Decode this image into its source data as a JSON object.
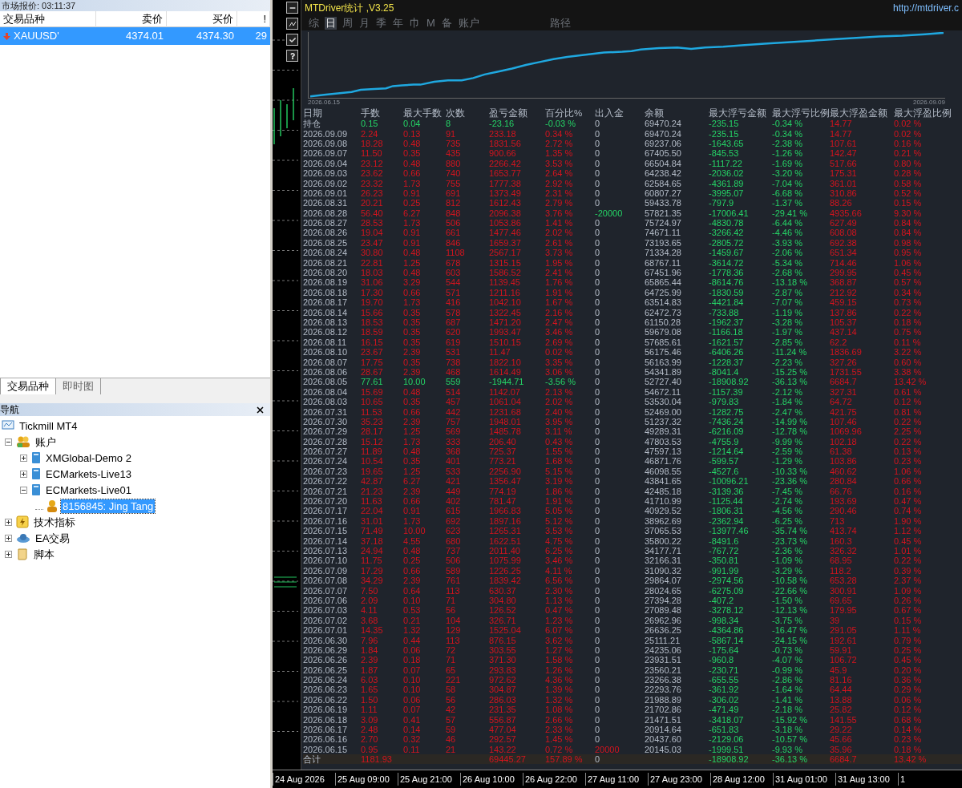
{
  "market_watch": {
    "title": "市场报价: 03:11:37",
    "columns": [
      "交易品种",
      "卖价",
      "买价",
      "!"
    ],
    "rows": [
      {
        "symbol": "XAUUSD'",
        "bid": "4374.01",
        "ask": "4374.30",
        "spread": "29",
        "selected": true
      }
    ],
    "tabs": [
      {
        "label": "交易品种",
        "selected": true
      },
      {
        "label": "即时图",
        "selected": false
      }
    ]
  },
  "navigator": {
    "title": "导航",
    "tree": [
      {
        "label": "Tickmill MT4",
        "kind": "platform",
        "selected": false,
        "children": [
          {
            "label": "账户",
            "kind": "accounts",
            "expanded": true,
            "selected": false,
            "children": [
              {
                "label": "XMGlobal-Demo 2",
                "kind": "server",
                "expanded": false,
                "selected": false
              },
              {
                "label": "ECMarkets-Live13",
                "kind": "server",
                "expanded": false,
                "selected": false
              },
              {
                "label": "ECMarkets-Live01",
                "kind": "server",
                "expanded": true,
                "selected": false,
                "children": [
                  {
                    "label": "8156845: Jing Tang",
                    "kind": "account",
                    "selected": true
                  }
                ]
              }
            ]
          },
          {
            "label": "技术指标",
            "kind": "indicators",
            "expanded": false,
            "selected": false
          },
          {
            "label": "EA交易",
            "kind": "experts",
            "expanded": false,
            "selected": false
          },
          {
            "label": "脚本",
            "kind": "scripts",
            "expanded": false,
            "selected": false
          }
        ]
      }
    ]
  },
  "stats_panel": {
    "title": "MTDriver统计 ,V3.25",
    "link": "http://mtdriver.c",
    "tabs": [
      {
        "label": "综",
        "selected": false
      },
      {
        "label": "日",
        "selected": true
      },
      {
        "label": "周",
        "selected": false
      },
      {
        "label": "月",
        "selected": false
      },
      {
        "label": "季",
        "selected": false
      },
      {
        "label": "年",
        "selected": false
      },
      {
        "label": "巾",
        "selected": false
      },
      {
        "label": "M",
        "selected": false
      },
      {
        "label": "备",
        "selected": false
      },
      {
        "label": "账户",
        "selected": false
      },
      {
        "label": "路径",
        "selected": false
      }
    ],
    "equity_chart": {
      "start_label": "2026.06.15",
      "end_label": "2026.09.09"
    },
    "table": {
      "columns": [
        "日期",
        "手数",
        "最大手数",
        "次数",
        "盈亏金额",
        "百分比%",
        "出入金",
        "余额",
        "最大浮亏金额",
        "最大浮亏比例",
        "最大浮盈金额",
        "最大浮盈比例"
      ],
      "rows": [
        {
          "kind": "loss",
          "flow": {
            "kind": "none"
          },
          "cells": [
            "持仓",
            "0.15",
            "0.04",
            "8",
            "-23.16",
            "-0.03 %",
            "0",
            "69470.24",
            "-235.15",
            "-0.34 %",
            "14.77",
            "0.02 %"
          ]
        },
        {
          "kind": "profit",
          "flow": {
            "kind": "none"
          },
          "cells": [
            "2026.09.09",
            "2.24",
            "0.13",
            "91",
            "233.18",
            "0.34 %",
            "0",
            "69470.24",
            "-235.15",
            "-0.34 %",
            "14.77",
            "0.02 %"
          ]
        },
        {
          "kind": "profit",
          "flow": {
            "kind": "none"
          },
          "cells": [
            "2026.09.08",
            "18.28",
            "0.48",
            "735",
            "1831.56",
            "2.72 %",
            "0",
            "69237.06",
            "-1643.65",
            "-2.38 %",
            "107.61",
            "0.16 %"
          ]
        },
        {
          "kind": "profit",
          "flow": {
            "kind": "none"
          },
          "cells": [
            "2026.09.07",
            "11.50",
            "0.35",
            "435",
            "900.66",
            "1.35 %",
            "0",
            "67405.50",
            "-845.53",
            "-1.26 %",
            "142.47",
            "0.21 %"
          ]
        },
        {
          "kind": "profit",
          "flow": {
            "kind": "none"
          },
          "cells": [
            "2026.09.04",
            "23.12",
            "0.48",
            "880",
            "2266.42",
            "3.53 %",
            "0",
            "66504.84",
            "-1117.22",
            "-1.69 %",
            "517.66",
            "0.80 %"
          ]
        },
        {
          "kind": "profit",
          "flow": {
            "kind": "none"
          },
          "cells": [
            "2026.09.03",
            "23.62",
            "0.66",
            "740",
            "1653.77",
            "2.64 %",
            "0",
            "64238.42",
            "-2036.02",
            "-3.20 %",
            "175.31",
            "0.28 %"
          ]
        },
        {
          "kind": "profit",
          "flow": {
            "kind": "none"
          },
          "cells": [
            "2026.09.02",
            "23.32",
            "1.73",
            "755",
            "1777.38",
            "2.92 %",
            "0",
            "62584.65",
            "-4361.89",
            "-7.04 %",
            "361.01",
            "0.58 %"
          ]
        },
        {
          "kind": "profit",
          "flow": {
            "kind": "none"
          },
          "cells": [
            "2026.09.01",
            "26.23",
            "0.91",
            "691",
            "1373.49",
            "2.31 %",
            "0",
            "60807.27",
            "-3995.07",
            "-6.68 %",
            "310.86",
            "0.52 %"
          ]
        },
        {
          "kind": "profit",
          "flow": {
            "kind": "none"
          },
          "cells": [
            "2026.08.31",
            "20.21",
            "0.25",
            "812",
            "1612.43",
            "2.79 %",
            "0",
            "59433.78",
            "-797.9",
            "-1.37 %",
            "88.26",
            "0.15 %"
          ]
        },
        {
          "kind": "profit",
          "flow": {
            "kind": "withdrawal"
          },
          "cells": [
            "2026.08.28",
            "56.40",
            "6.27",
            "848",
            "2096.38",
            "3.76 %",
            "-20000",
            "57821.35",
            "-17006.41",
            "-29.41 %",
            "4935.66",
            "9.30 %"
          ]
        },
        {
          "kind": "profit",
          "flow": {
            "kind": "none"
          },
          "cells": [
            "2026.08.27",
            "28.53",
            "1.73",
            "506",
            "1053.86",
            "1.41 %",
            "0",
            "75724.97",
            "-4830.78",
            "-6.44 %",
            "627.49",
            "0.84 %"
          ]
        },
        {
          "kind": "profit",
          "flow": {
            "kind": "none"
          },
          "cells": [
            "2026.08.26",
            "19.04",
            "0.91",
            "661",
            "1477.46",
            "2.02 %",
            "0",
            "74671.11",
            "-3266.42",
            "-4.46 %",
            "608.08",
            "0.84 %"
          ]
        },
        {
          "kind": "profit",
          "flow": {
            "kind": "none"
          },
          "cells": [
            "2026.08.25",
            "23.47",
            "0.91",
            "846",
            "1659.37",
            "2.61 %",
            "0",
            "73193.65",
            "-2805.72",
            "-3.93 %",
            "692.38",
            "0.98 %"
          ]
        },
        {
          "kind": "profit",
          "flow": {
            "kind": "none"
          },
          "cells": [
            "2026.08.24",
            "30.80",
            "0.48",
            "1108",
            "2567.17",
            "3.73 %",
            "0",
            "71334.28",
            "-1459.67",
            "-2.06 %",
            "651.34",
            "0.95 %"
          ]
        },
        {
          "kind": "profit",
          "flow": {
            "kind": "none"
          },
          "cells": [
            "2026.08.21",
            "22.81",
            "1.25",
            "678",
            "1315.15",
            "1.95 %",
            "0",
            "68767.11",
            "-3614.72",
            "-5.34 %",
            "714.46",
            "1.06 %"
          ]
        },
        {
          "kind": "profit",
          "flow": {
            "kind": "none"
          },
          "cells": [
            "2026.08.20",
            "18.03",
            "0.48",
            "603",
            "1586.52",
            "2.41 %",
            "0",
            "67451.96",
            "-1778.36",
            "-2.68 %",
            "299.95",
            "0.45 %"
          ]
        },
        {
          "kind": "profit",
          "flow": {
            "kind": "none"
          },
          "cells": [
            "2026.08.19",
            "31.06",
            "3.29",
            "544",
            "1139.45",
            "1.76 %",
            "0",
            "65865.44",
            "-8614.76",
            "-13.18 %",
            "368.87",
            "0.57 %"
          ]
        },
        {
          "kind": "profit",
          "flow": {
            "kind": "none"
          },
          "cells": [
            "2026.08.18",
            "17.30",
            "0.66",
            "571",
            "1211.16",
            "1.91 %",
            "0",
            "64725.99",
            "-1830.59",
            "-2.87 %",
            "212.92",
            "0.34 %"
          ]
        },
        {
          "kind": "profit",
          "flow": {
            "kind": "none"
          },
          "cells": [
            "2026.08.17",
            "19.70",
            "1.73",
            "416",
            "1042.10",
            "1.67 %",
            "0",
            "63514.83",
            "-4421.84",
            "-7.07 %",
            "459.15",
            "0.73 %"
          ]
        },
        {
          "kind": "profit",
          "flow": {
            "kind": "none"
          },
          "cells": [
            "2026.08.14",
            "15.66",
            "0.35",
            "578",
            "1322.45",
            "2.16 %",
            "0",
            "62472.73",
            "-733.88",
            "-1.19 %",
            "137.86",
            "0.22 %"
          ]
        },
        {
          "kind": "profit",
          "flow": {
            "kind": "none"
          },
          "cells": [
            "2026.08.13",
            "18.53",
            "0.35",
            "687",
            "1471.20",
            "2.47 %",
            "0",
            "61150.28",
            "-1962.37",
            "-3.28 %",
            "105.37",
            "0.18 %"
          ]
        },
        {
          "kind": "profit",
          "flow": {
            "kind": "none"
          },
          "cells": [
            "2026.08.12",
            "18.59",
            "0.35",
            "620",
            "1993.47",
            "3.46 %",
            "0",
            "59679.08",
            "-1166.18",
            "-1.97 %",
            "437.14",
            "0.75 %"
          ]
        },
        {
          "kind": "profit",
          "flow": {
            "kind": "none"
          },
          "cells": [
            "2026.08.11",
            "16.15",
            "0.35",
            "619",
            "1510.15",
            "2.69 %",
            "0",
            "57685.61",
            "-1621.57",
            "-2.85 %",
            "62.2",
            "0.11 %"
          ]
        },
        {
          "kind": "profit",
          "flow": {
            "kind": "none"
          },
          "cells": [
            "2026.08.10",
            "23.67",
            "2.39",
            "531",
            "11.47",
            "0.02 %",
            "0",
            "56175.46",
            "-6406.26",
            "-11.24 %",
            "1836.69",
            "3.22 %"
          ]
        },
        {
          "kind": "profit",
          "flow": {
            "kind": "none"
          },
          "cells": [
            "2026.08.07",
            "17.75",
            "0.35",
            "738",
            "1822.10",
            "3.35 %",
            "0",
            "56163.99",
            "-1228.37",
            "-2.23 %",
            "327.26",
            "0.60 %"
          ]
        },
        {
          "kind": "profit",
          "flow": {
            "kind": "none"
          },
          "cells": [
            "2026.08.06",
            "28.67",
            "2.39",
            "468",
            "1614.49",
            "3.06 %",
            "0",
            "54341.89",
            "-8041.4",
            "-15.25 %",
            "1731.55",
            "3.38 %"
          ]
        },
        {
          "kind": "loss",
          "flow": {
            "kind": "none"
          },
          "cells": [
            "2026.08.05",
            "77.61",
            "10.00",
            "559",
            "-1944.71",
            "-3.56 %",
            "0",
            "52727.40",
            "-18908.92",
            "-36.13 %",
            "6684.7",
            "13.42 %"
          ]
        },
        {
          "kind": "profit",
          "flow": {
            "kind": "none"
          },
          "cells": [
            "2026.08.04",
            "15.69",
            "0.48",
            "514",
            "1142.07",
            "2.13 %",
            "0",
            "54672.11",
            "-1157.39",
            "-2.12 %",
            "327.31",
            "0.61 %"
          ]
        },
        {
          "kind": "profit",
          "flow": {
            "kind": "none"
          },
          "cells": [
            "2026.08.03",
            "10.65",
            "0.35",
            "457",
            "1061.04",
            "2.02 %",
            "0",
            "53530.04",
            "-979.83",
            "-1.84 %",
            "64.72",
            "0.12 %"
          ]
        },
        {
          "kind": "profit",
          "flow": {
            "kind": "none"
          },
          "cells": [
            "2026.07.31",
            "11.53",
            "0.66",
            "442",
            "1231.68",
            "2.40 %",
            "0",
            "52469.00",
            "-1282.75",
            "-2.47 %",
            "421.75",
            "0.81 %"
          ]
        },
        {
          "kind": "profit",
          "flow": {
            "kind": "none"
          },
          "cells": [
            "2026.07.30",
            "35.23",
            "2.39",
            "757",
            "1948.01",
            "3.95 %",
            "0",
            "51237.32",
            "-7436.24",
            "-14.99 %",
            "107.46",
            "0.22 %"
          ]
        },
        {
          "kind": "profit",
          "flow": {
            "kind": "none"
          },
          "cells": [
            "2026.07.29",
            "28.17",
            "1.25",
            "569",
            "1485.78",
            "3.11 %",
            "0",
            "49289.31",
            "-6216.09",
            "-12.78 %",
            "1069.96",
            "2.25 %"
          ]
        },
        {
          "kind": "profit",
          "flow": {
            "kind": "none"
          },
          "cells": [
            "2026.07.28",
            "15.12",
            "1.73",
            "333",
            "206.40",
            "0.43 %",
            "0",
            "47803.53",
            "-4755.9",
            "-9.99 %",
            "102.18",
            "0.22 %"
          ]
        },
        {
          "kind": "profit",
          "flow": {
            "kind": "none"
          },
          "cells": [
            "2026.07.27",
            "11.89",
            "0.48",
            "368",
            "725.37",
            "1.55 %",
            "0",
            "47597.13",
            "-1214.64",
            "-2.59 %",
            "61.38",
            "0.13 %"
          ]
        },
        {
          "kind": "profit",
          "flow": {
            "kind": "none"
          },
          "cells": [
            "2026.07.24",
            "10.54",
            "0.35",
            "401",
            "773.21",
            "1.68 %",
            "0",
            "46871.76",
            "-599.57",
            "-1.29 %",
            "103.86",
            "0.23 %"
          ]
        },
        {
          "kind": "profit",
          "flow": {
            "kind": "none"
          },
          "cells": [
            "2026.07.23",
            "19.65",
            "1.25",
            "533",
            "2256.90",
            "5.15 %",
            "0",
            "46098.55",
            "-4527.6",
            "-10.33 %",
            "460.62",
            "1.06 %"
          ]
        },
        {
          "kind": "profit",
          "flow": {
            "kind": "none"
          },
          "cells": [
            "2026.07.22",
            "42.87",
            "6.27",
            "421",
            "1356.47",
            "3.19 %",
            "0",
            "43841.65",
            "-10096.21",
            "-23.36 %",
            "280.84",
            "0.66 %"
          ]
        },
        {
          "kind": "profit",
          "flow": {
            "kind": "none"
          },
          "cells": [
            "2026.07.21",
            "21.23",
            "2.39",
            "449",
            "774.19",
            "1.86 %",
            "0",
            "42485.18",
            "-3139.36",
            "-7.45 %",
            "66.76",
            "0.16 %"
          ]
        },
        {
          "kind": "profit",
          "flow": {
            "kind": "none"
          },
          "cells": [
            "2026.07.20",
            "11.63",
            "0.66",
            "402",
            "781.47",
            "1.91 %",
            "0",
            "41710.99",
            "-1125.44",
            "-2.74 %",
            "193.69",
            "0.47 %"
          ]
        },
        {
          "kind": "profit",
          "flow": {
            "kind": "none"
          },
          "cells": [
            "2026.07.17",
            "22.04",
            "0.91",
            "615",
            "1966.83",
            "5.05 %",
            "0",
            "40929.52",
            "-1806.31",
            "-4.56 %",
            "290.46",
            "0.74 %"
          ]
        },
        {
          "kind": "profit",
          "flow": {
            "kind": "none"
          },
          "cells": [
            "2026.07.16",
            "31.01",
            "1.73",
            "692",
            "1897.16",
            "5.12 %",
            "0",
            "38962.69",
            "-2362.94",
            "-6.25 %",
            "713",
            "1.90 %"
          ]
        },
        {
          "kind": "profit",
          "flow": {
            "kind": "none"
          },
          "cells": [
            "2026.07.15",
            "71.49",
            "10.00",
            "623",
            "1265.31",
            "3.53 %",
            "0",
            "37065.53",
            "-13977.46",
            "-35.74 %",
            "413.74",
            "1.12 %"
          ]
        },
        {
          "kind": "profit",
          "flow": {
            "kind": "none"
          },
          "cells": [
            "2026.07.14",
            "37.18",
            "4.55",
            "680",
            "1622.51",
            "4.75 %",
            "0",
            "35800.22",
            "-8491.6",
            "-23.73 %",
            "160.3",
            "0.45 %"
          ]
        },
        {
          "kind": "profit",
          "flow": {
            "kind": "none"
          },
          "cells": [
            "2026.07.13",
            "24.94",
            "0.48",
            "737",
            "2011.40",
            "6.25 %",
            "0",
            "34177.71",
            "-767.72",
            "-2.36 %",
            "326.32",
            "1.01 %"
          ]
        },
        {
          "kind": "profit",
          "flow": {
            "kind": "none"
          },
          "cells": [
            "2026.07.10",
            "11.75",
            "0.25",
            "506",
            "1075.99",
            "3.46 %",
            "0",
            "32166.31",
            "-350.81",
            "-1.09 %",
            "68.95",
            "0.22 %"
          ]
        },
        {
          "kind": "profit",
          "flow": {
            "kind": "none"
          },
          "cells": [
            "2026.07.09",
            "17.29",
            "0.66",
            "589",
            "1226.25",
            "4.11 %",
            "0",
            "31090.32",
            "-991.99",
            "-3.29 %",
            "118.2",
            "0.39 %"
          ]
        },
        {
          "kind": "profit",
          "flow": {
            "kind": "none"
          },
          "cells": [
            "2026.07.08",
            "34.29",
            "2.39",
            "761",
            "1839.42",
            "6.56 %",
            "0",
            "29864.07",
            "-2974.56",
            "-10.58 %",
            "653.28",
            "2.37 %"
          ]
        },
        {
          "kind": "profit",
          "flow": {
            "kind": "none"
          },
          "cells": [
            "2026.07.07",
            "7.50",
            "0.64",
            "113",
            "630.37",
            "2.30 %",
            "0",
            "28024.65",
            "-6275.09",
            "-22.66 %",
            "300.91",
            "1.09 %"
          ]
        },
        {
          "kind": "profit",
          "flow": {
            "kind": "none"
          },
          "cells": [
            "2026.07.06",
            "2.09",
            "0.10",
            "71",
            "304.80",
            "1.13 %",
            "0",
            "27394.28",
            "-407.2",
            "-1.50 %",
            "69.65",
            "0.26 %"
          ]
        },
        {
          "kind": "profit",
          "flow": {
            "kind": "none"
          },
          "cells": [
            "2026.07.03",
            "4.11",
            "0.53",
            "56",
            "126.52",
            "0.47 %",
            "0",
            "27089.48",
            "-3278.12",
            "-12.13 %",
            "179.95",
            "0.67 %"
          ]
        },
        {
          "kind": "profit",
          "flow": {
            "kind": "none"
          },
          "cells": [
            "2026.07.02",
            "3.68",
            "0.21",
            "104",
            "326.71",
            "1.23 %",
            "0",
            "26962.96",
            "-998.34",
            "-3.75 %",
            "39",
            "0.15 %"
          ]
        },
        {
          "kind": "profit",
          "flow": {
            "kind": "none"
          },
          "cells": [
            "2026.07.01",
            "14.35",
            "1.32",
            "129",
            "1525.04",
            "6.07 %",
            "0",
            "26636.25",
            "-4364.86",
            "-16.47 %",
            "291.05",
            "1.11 %"
          ]
        },
        {
          "kind": "profit",
          "flow": {
            "kind": "none"
          },
          "cells": [
            "2026.06.30",
            "7.96",
            "0.44",
            "113",
            "876.15",
            "3.62 %",
            "0",
            "25111.21",
            "-5867.14",
            "-24.15 %",
            "192.61",
            "0.79 %"
          ]
        },
        {
          "kind": "profit",
          "flow": {
            "kind": "none"
          },
          "cells": [
            "2026.06.29",
            "1.84",
            "0.06",
            "72",
            "303.55",
            "1.27 %",
            "0",
            "24235.06",
            "-175.64",
            "-0.73 %",
            "59.91",
            "0.25 %"
          ]
        },
        {
          "kind": "profit",
          "flow": {
            "kind": "none"
          },
          "cells": [
            "2026.06.26",
            "2.39",
            "0.18",
            "71",
            "371.30",
            "1.58 %",
            "0",
            "23931.51",
            "-960.8",
            "-4.07 %",
            "106.72",
            "0.45 %"
          ]
        },
        {
          "kind": "profit",
          "flow": {
            "kind": "none"
          },
          "cells": [
            "2026.06.25",
            "1.87",
            "0.07",
            "65",
            "293.83",
            "1.26 %",
            "0",
            "23560.21",
            "-230.71",
            "-0.99 %",
            "45.9",
            "0.20 %"
          ]
        },
        {
          "kind": "profit",
          "flow": {
            "kind": "none"
          },
          "cells": [
            "2026.06.24",
            "6.03",
            "0.10",
            "221",
            "972.62",
            "4.36 %",
            "0",
            "23266.38",
            "-655.55",
            "-2.86 %",
            "81.16",
            "0.36 %"
          ]
        },
        {
          "kind": "profit",
          "flow": {
            "kind": "none"
          },
          "cells": [
            "2026.06.23",
            "1.65",
            "0.10",
            "58",
            "304.87",
            "1.39 %",
            "0",
            "22293.76",
            "-361.92",
            "-1.64 %",
            "64.44",
            "0.29 %"
          ]
        },
        {
          "kind": "profit",
          "flow": {
            "kind": "none"
          },
          "cells": [
            "2026.06.22",
            "1.50",
            "0.06",
            "56",
            "286.03",
            "1.32 %",
            "0",
            "21988.89",
            "-306.02",
            "-1.41 %",
            "13.88",
            "0.06 %"
          ]
        },
        {
          "kind": "profit",
          "flow": {
            "kind": "none"
          },
          "cells": [
            "2026.06.19",
            "1.11",
            "0.07",
            "42",
            "231.35",
            "1.08 %",
            "0",
            "21702.86",
            "-471.49",
            "-2.18 %",
            "25.82",
            "0.12 %"
          ]
        },
        {
          "kind": "profit",
          "flow": {
            "kind": "none"
          },
          "cells": [
            "2026.06.18",
            "3.09",
            "0.41",
            "57",
            "556.87",
            "2.66 %",
            "0",
            "21471.51",
            "-3418.07",
            "-15.92 %",
            "141.55",
            "0.68 %"
          ]
        },
        {
          "kind": "profit",
          "flow": {
            "kind": "none"
          },
          "cells": [
            "2026.06.17",
            "2.48",
            "0.14",
            "59",
            "477.04",
            "2.33 %",
            "0",
            "20914.64",
            "-651.83",
            "-3.18 %",
            "29.22",
            "0.14 %"
          ]
        },
        {
          "kind": "profit",
          "flow": {
            "kind": "none"
          },
          "cells": [
            "2026.06.16",
            "2.70",
            "0.32",
            "46",
            "292.57",
            "1.45 %",
            "0",
            "20437.60",
            "-2129.06",
            "-10.57 %",
            "45.66",
            "0.23 %"
          ]
        },
        {
          "kind": "profit",
          "flow": {
            "kind": "deposit"
          },
          "cells": [
            "2026.06.15",
            "0.95",
            "0.11",
            "21",
            "143.22",
            "0.72 %",
            "20000",
            "20145.03",
            "-1999.51",
            "-9.93 %",
            "35.96",
            "0.18 %"
          ]
        },
        {
          "kind": "total",
          "flow": {
            "kind": "none"
          },
          "cells": [
            "合计",
            "1181.93",
            null,
            null,
            "69445.27",
            "157.89 %",
            "0",
            null,
            "-18908.92",
            "-36.13 %",
            "6684.7",
            "13.42 %"
          ]
        }
      ]
    }
  },
  "time_axis": [
    "24 Aug 2026",
    "25 Aug 09:00",
    "25 Aug 21:00",
    "26 Aug 10:00",
    "26 Aug 22:00",
    "27 Aug 11:00",
    "27 Aug 23:00",
    "28 Aug 12:00",
    "31 Aug 01:00",
    "31 Aug 13:00",
    "1"
  ]
}
